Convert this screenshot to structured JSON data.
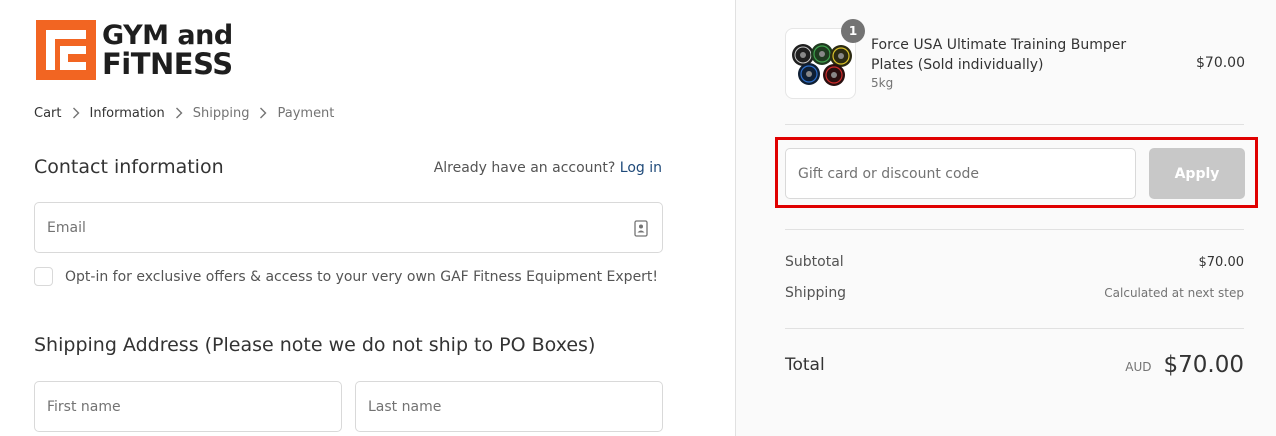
{
  "brand": {
    "logo_line1": "GYM and",
    "logo_line2": "FiTNESS",
    "accent_color": "#f26522"
  },
  "breadcrumb": {
    "items": [
      {
        "label": "Cart",
        "state": "done"
      },
      {
        "label": "Information",
        "state": "current"
      },
      {
        "label": "Shipping",
        "state": "upcoming"
      },
      {
        "label": "Payment",
        "state": "upcoming"
      }
    ],
    "separator_icon": "chevron-right-icon"
  },
  "contact": {
    "title": "Contact information",
    "login_prompt": "Already have an account?",
    "login_link": "Log in",
    "email_placeholder": "Email",
    "email_icon": "contact-card-icon",
    "optin_label": "Opt-in for exclusive offers & access to your very own GAF Fitness Equipment Expert!"
  },
  "shipping": {
    "title": "Shipping Address (Please note we do not ship to PO Boxes)",
    "first_name_placeholder": "First name",
    "last_name_placeholder": "Last name"
  },
  "summary": {
    "product": {
      "name": "Force USA Ultimate Training Bumper Plates (Sold individually)",
      "variant": "5kg",
      "price": "$70.00",
      "quantity": "1"
    },
    "discount": {
      "placeholder": "Gift card or discount code",
      "apply_label": "Apply",
      "highlight_color": "#e00000"
    },
    "subtotal_label": "Subtotal",
    "subtotal_value": "$70.00",
    "shipping_label": "Shipping",
    "shipping_value": "Calculated at next step",
    "total_label": "Total",
    "currency": "AUD",
    "total_value": "$70.00"
  }
}
